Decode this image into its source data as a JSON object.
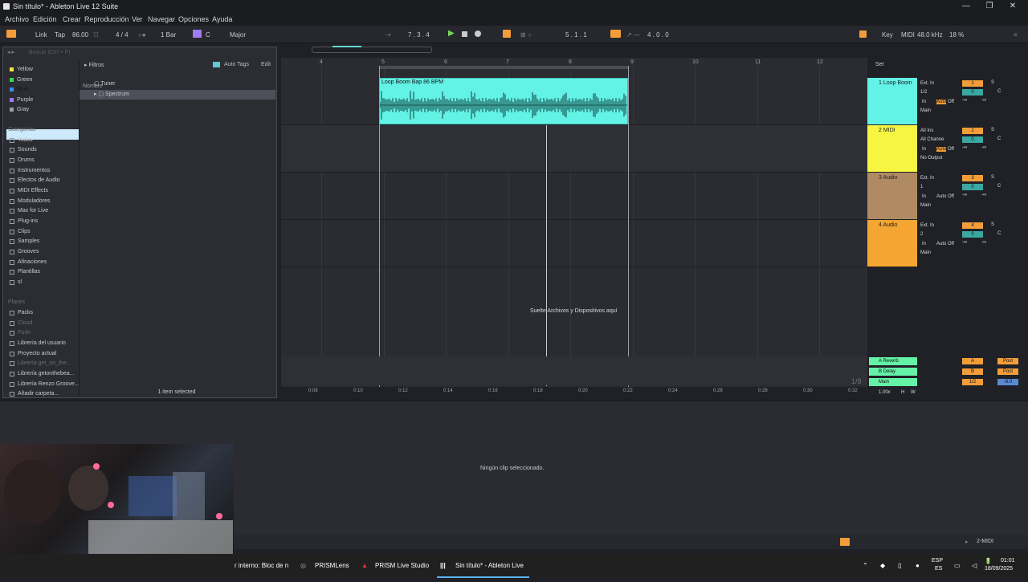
{
  "window": {
    "title": "Sin título* - Ableton Live 12 Suite",
    "minimize": "—",
    "maximize": "❐",
    "close": "✕"
  },
  "menu": [
    "Archivo",
    "Edición",
    "Crear",
    "Reproducción",
    "Ver",
    "Navegar",
    "Opciones",
    "Ayuda"
  ],
  "control": {
    "link": "Link",
    "tap": "Tap",
    "tempo": "86.00",
    "signature": "4 / 4",
    "quantize": "1 Bar",
    "key": "C",
    "scale": "Major",
    "position": "7 .  3 .  4",
    "loop_start": "5 .  1 .  1",
    "loop_length": "4 .  0 .  0",
    "key_label": "Key",
    "midi_label": "MIDI",
    "sample_rate": "48.0 kHz",
    "cpu": "18 %"
  },
  "browser": {
    "search_placeholder": "Buscar (Ctrl + F)",
    "colors": [
      {
        "label": "Yellow",
        "color": "#f5e342"
      },
      {
        "label": "Green",
        "color": "#3ad94c"
      },
      {
        "label": "Blue",
        "color": "#3a8df2"
      },
      {
        "label": "Purple",
        "color": "#a07af2"
      },
      {
        "label": "Gray",
        "color": "#9aa0a8"
      }
    ],
    "categories_header": "Categorías",
    "categories": [
      "Todos",
      "Sounds",
      "Drums",
      "Instrumentos",
      "Efectos de Audio",
      "MIDI Effects",
      "Moduladores",
      "Max for Live",
      "Plug-ins",
      "Clips",
      "Samples",
      "Grooves",
      "Afinaciones",
      "Plantillas",
      "sl"
    ],
    "places_header": "Places",
    "places": [
      "Packs",
      "Cloud",
      "Push",
      "Librería del usuario",
      "Proyecto actual",
      "Librería get_on_the...",
      "Librería getonthebea...",
      "Librería Renzo Groove...",
      "Añadir carpeta..."
    ],
    "filters": "Filtros",
    "auto_tags": "Auto Tags",
    "edit": "Edit",
    "name_header": "Nombre",
    "items": [
      "Tuner",
      "Spectrum"
    ],
    "status": "1 item selected"
  },
  "arrangement": {
    "ruler": [
      "4",
      "5",
      "6",
      "7",
      "8",
      "9",
      "10",
      "11",
      "12"
    ],
    "clip_name": "Loop Boom Bap 86 BPM",
    "drop_message": "Suelte Archivos y Dispositivos aquí",
    "times": [
      "0:08",
      "0:10",
      "0:12",
      "0:14",
      "0:16",
      "0:18",
      "0:20",
      "0:22",
      "0:24",
      "0:26",
      "0:28",
      "0:30",
      "0:32"
    ],
    "zoom": "1/8"
  },
  "tracks": [
    {
      "name": "1 Loop Boom",
      "color": "#63f2e6",
      "input": "Ext. In",
      "channel": "1/2",
      "output": "Main",
      "num": "1"
    },
    {
      "name": "2 MIDI",
      "color": "#f5f542",
      "input": "All Ins",
      "channel": "All Channe",
      "output": "No Output",
      "num": "2"
    },
    {
      "name": "3 Audio",
      "color": "#b08a62",
      "input": "Ext. In",
      "channel": "1",
      "output": "Main",
      "num": "3"
    },
    {
      "name": "4 Audio",
      "color": "#f5a532",
      "input": "Ext. In",
      "channel": "2",
      "output": "Main",
      "num": "4"
    }
  ],
  "track_controls": {
    "in": "In",
    "auto": "Auto",
    "off": "Off",
    "vol": "0",
    "pan": "C",
    "inf": "-∞",
    "solo": "S"
  },
  "returns": [
    {
      "name": "A Reverb",
      "btn": "A",
      "post": "Post"
    },
    {
      "name": "B Delay",
      "btn": "B",
      "post": "Post"
    },
    {
      "name": "Main",
      "btn": "1/2",
      "post": "-6.0"
    }
  ],
  "arr_footer": {
    "zoom_pct": "1.00x",
    "h": "H",
    "w": "W"
  },
  "detail": {
    "message": "Ningún clip seleccionado."
  },
  "bottom": {
    "track": "2-MIDI"
  },
  "taskbar": {
    "apps": [
      "r interno: Bloc de n",
      "PRISMLens",
      "PRISM Live Studio",
      "Sin título* - Ableton Live"
    ],
    "lang": "ESP",
    "lang2": "ES",
    "time": "01:01",
    "date": "18/09/2025"
  }
}
